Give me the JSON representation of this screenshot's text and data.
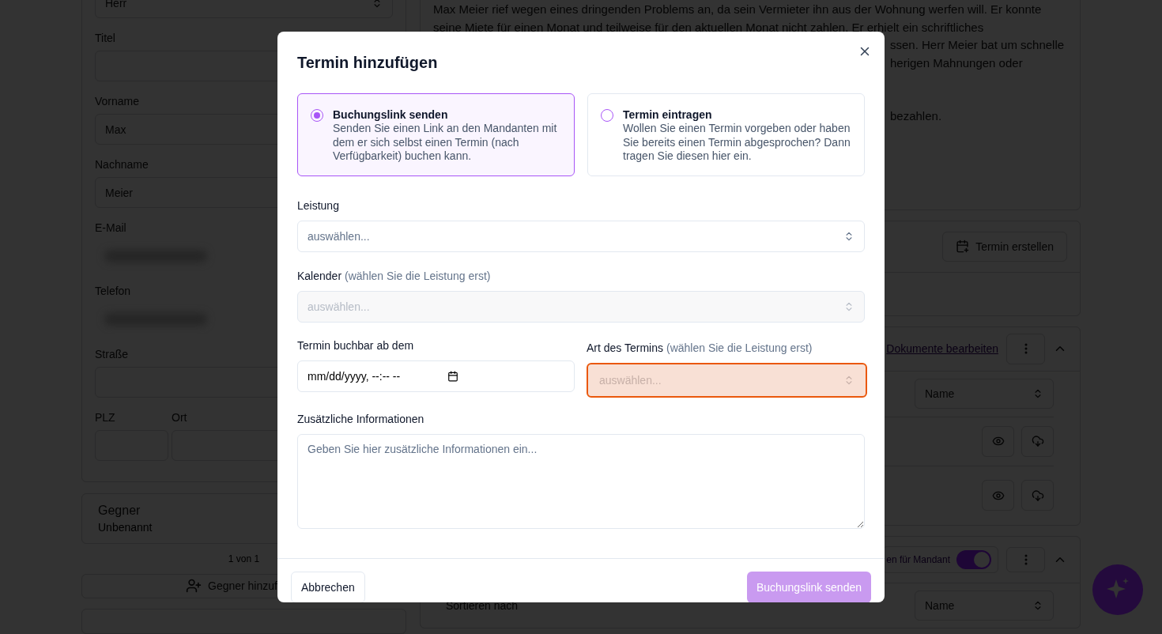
{
  "client_panel": {
    "salutation": {
      "value": "Herr"
    },
    "fields": [
      {
        "label": "Titel",
        "kind": "text"
      },
      {
        "label": "Vorname",
        "kind": "text",
        "value": "Max"
      },
      {
        "label": "Nachname",
        "kind": "text",
        "value": "Meier"
      },
      {
        "label": "E-Mail",
        "kind": "blurred"
      },
      {
        "label": "Telefon",
        "kind": "blurred"
      },
      {
        "label": "Straße",
        "kind": "text"
      }
    ],
    "address_row": [
      {
        "label": "PLZ"
      },
      {
        "label": "Ort"
      }
    ]
  },
  "opponent_card": {
    "title": "Gegner",
    "subtitle": "Unbenannt"
  },
  "pager": "1 von 1",
  "add_opponent_button": "Gegner hinzuf",
  "case_notes": {
    "lines": [
      {
        "kind": "full",
        "text": "Max Meier rief wegen eines dringenden Problems an, da sein Vermieter ihn aus der Wohnung werfen will. Er konnte"
      },
      {
        "kind": "full",
        "text": "seine Miete für einen Monat und teilweise für den aktuellen Monat nicht zahlen. Er erhielt ein schriftliches"
      },
      {
        "kind": "tail",
        "text": "ssen. Herr Meier bat um schnelle"
      },
      {
        "kind": "tail",
        "text": "herigen Mahnungen oder"
      },
      {
        "kind": "tail_after_gap",
        "text": "bezahlen."
      }
    ]
  },
  "appointments": {
    "create_button": "Termin erstellen"
  },
  "documents": {
    "edit_link": "Dokumente bearbeiten",
    "sort": {
      "value": "Name"
    },
    "rows": [
      {
        "kind": "file_actions"
      },
      {
        "kind": "file_actions"
      }
    ]
  },
  "shared_section": {
    "toggle": {
      "label": "en für Mandant",
      "on": true
    },
    "sort_label": "Sortieren nach",
    "sort": {
      "value": "Name"
    }
  },
  "dialog": {
    "title": "Termin hinzufügen",
    "modes": [
      {
        "title": "Buchungslink senden",
        "description": "Senden Sie einen Link an den Mandanten mit dem er sich selbst einen Termin (nach Verfügbarkeit) buchen kann.",
        "selected": true
      },
      {
        "title": "Termin eintragen",
        "description": "Wollen Sie einen Termin vorgeben oder haben Sie bereits einen Termin abgesprochen? Dann tragen Sie diesen hier ein.",
        "selected": false
      }
    ],
    "fields": [
      {
        "label": "Leistung",
        "placeholder": "auswählen...",
        "disabled": false,
        "invalid": false
      },
      {
        "label": "Kalender",
        "hint": "(wählen Sie die Leistung erst)",
        "placeholder": "auswählen...",
        "disabled": true,
        "invalid": false
      }
    ],
    "date_field": {
      "label": "Termin buchbar ab dem",
      "placeholder": "mm/dd/yyyy, --:-- --"
    },
    "type_field": {
      "label": "Art des Termins",
      "hint": "(wählen Sie die Leistung erst)",
      "placeholder": "auswählen...",
      "invalid": true
    },
    "notes_field": {
      "label": "Zusätzliche Informationen",
      "placeholder": "Geben Sie hier zusätzliche Informationen ein..."
    },
    "cancel_button": "Abbrechen",
    "submit_button": {
      "label": "Buchungslink senden",
      "disabled": true
    }
  }
}
